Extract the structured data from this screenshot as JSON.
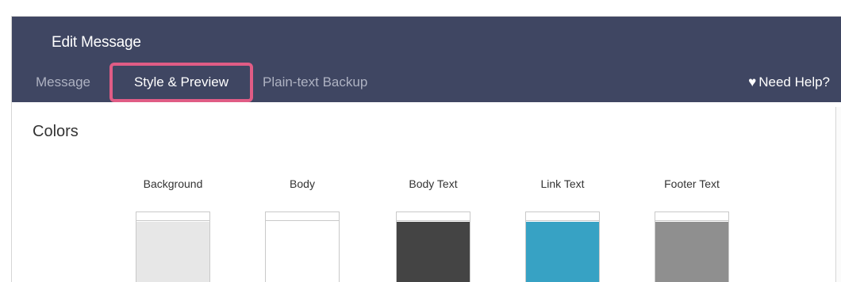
{
  "modal": {
    "title": "Edit Message"
  },
  "tabs": [
    {
      "label": "Message",
      "active": false
    },
    {
      "label": "Style & Preview",
      "active": true
    },
    {
      "label": "Plain-text Backup",
      "active": false
    }
  ],
  "help": {
    "label": "Need Help?",
    "icon": "heart-icon"
  },
  "colors": {
    "section_title": "Colors",
    "swatches": [
      {
        "label": "Background",
        "color": "#e7e7e7"
      },
      {
        "label": "Body",
        "color": "#ffffff"
      },
      {
        "label": "Body Text",
        "color": "#444444"
      },
      {
        "label": "Link Text",
        "color": "#37a2c4"
      },
      {
        "label": "Footer Text",
        "color": "#8f8f8f"
      }
    ]
  },
  "theme": {
    "header_bg": "#3f4662",
    "highlight": "#e05c85"
  }
}
